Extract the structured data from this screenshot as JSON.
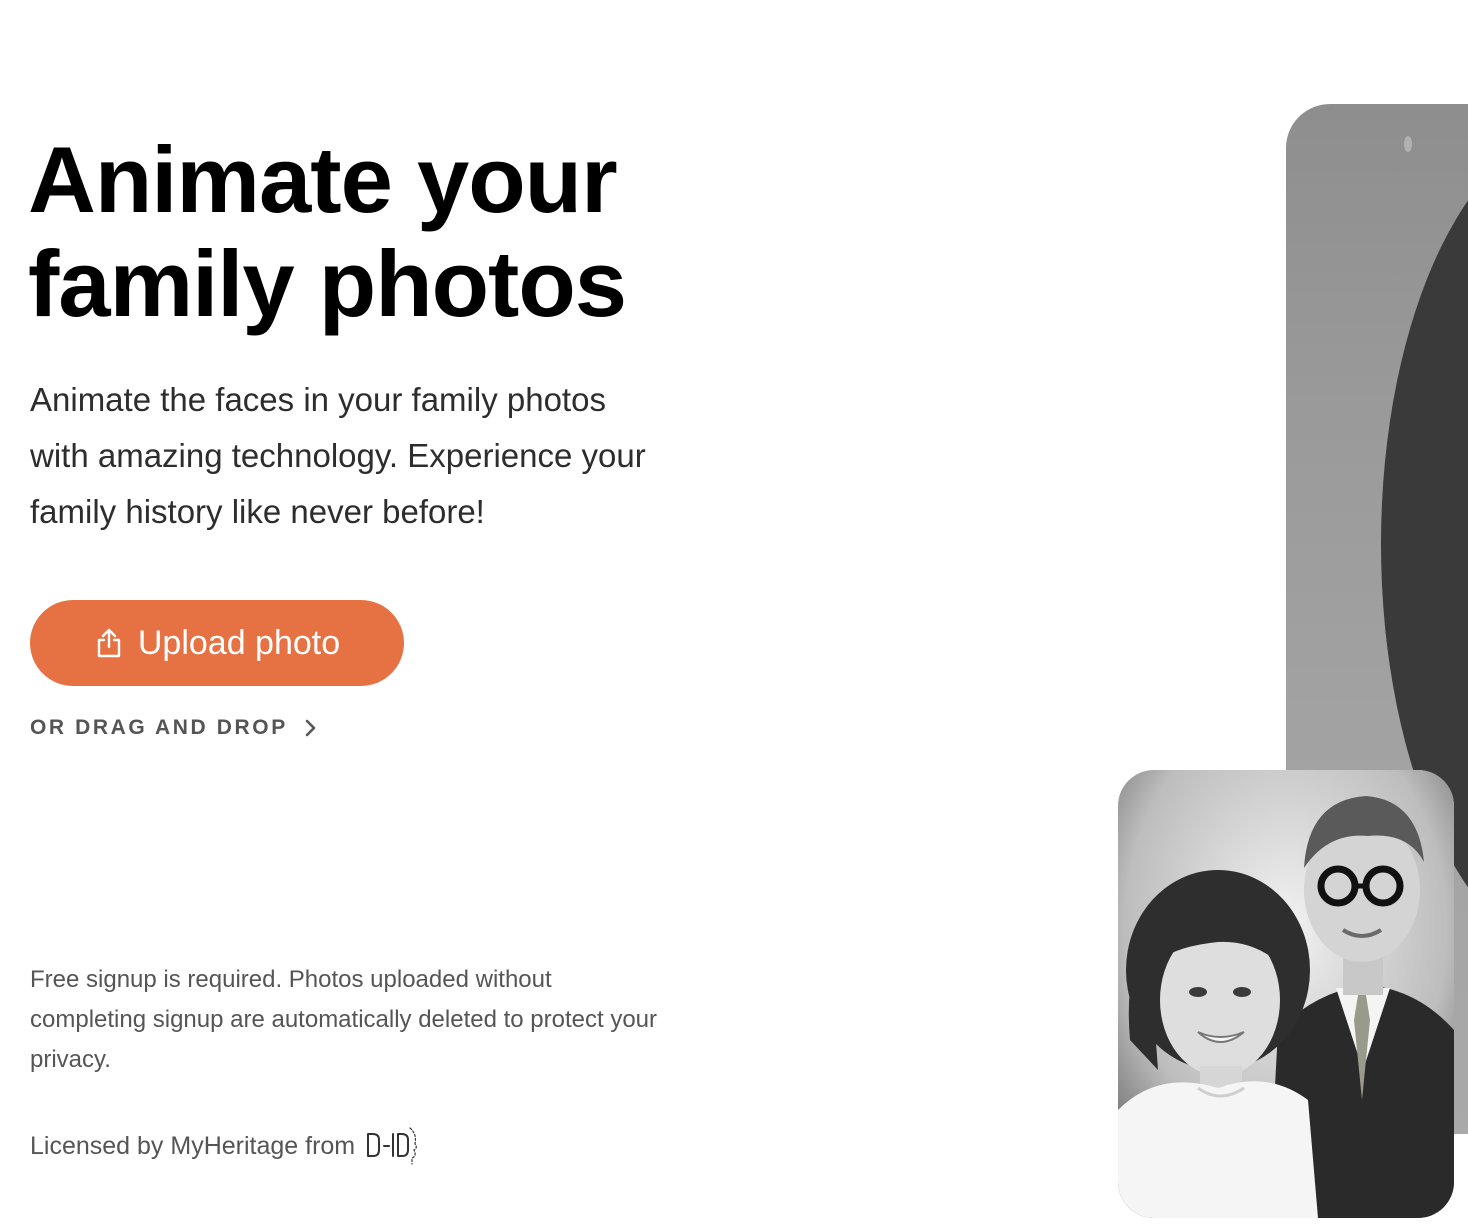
{
  "hero": {
    "title_line1": "Animate your",
    "title_line2": "family photos",
    "subtitle_line1": "Animate the faces in your family photos",
    "subtitle_line2": "with amazing technology. Experience your",
    "subtitle_line3": "family history like never before!"
  },
  "actions": {
    "upload_label": "Upload photo",
    "upload_icon": "upload-icon",
    "drag_drop_label": "OR DRAG AND DROP",
    "drag_drop_icon": "chevron-right-icon"
  },
  "fine_print": {
    "line1": "Free signup is required. Photos uploaded without",
    "line2": "completing signup are automatically deleted to protect your",
    "line3": "privacy."
  },
  "license": {
    "text": "Licensed by MyHeritage from",
    "logo": "D-ID"
  },
  "colors": {
    "accent": "#e67244",
    "text_primary": "#000000",
    "text_secondary": "#555555"
  }
}
